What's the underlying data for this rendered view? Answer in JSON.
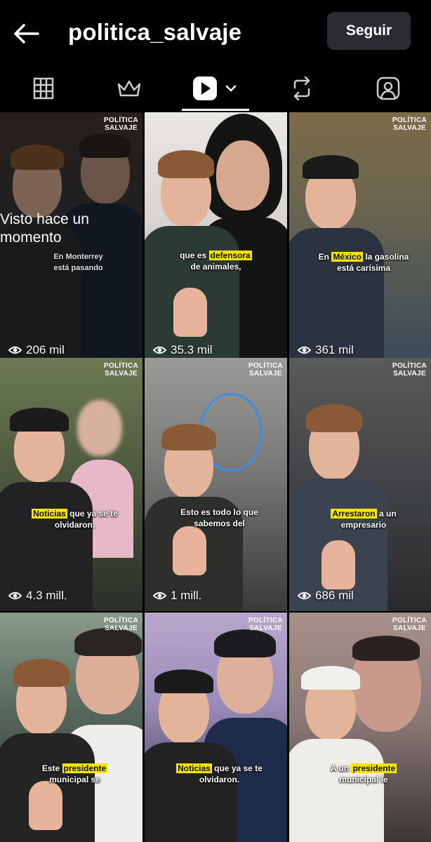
{
  "header": {
    "back_icon": "arrow-left-icon",
    "title": "politica_salvaje",
    "follow_label": "Seguir"
  },
  "tabs": [
    {
      "name": "grid",
      "icon": "grid-icon"
    },
    {
      "name": "crown",
      "icon": "crown-icon"
    },
    {
      "name": "videos",
      "icon": "play-icon",
      "active": true
    },
    {
      "name": "reposts",
      "icon": "repost-icon"
    },
    {
      "name": "tagged",
      "icon": "tagged-person-icon"
    }
  ],
  "videos": [
    {
      "brand": "POLÍTICA\nSALVAJE",
      "watched_label": "Visto hace un momento",
      "caption": "En Monterrey\nestá pasando",
      "caption_highlight": "",
      "views": "206 mil"
    },
    {
      "brand": "",
      "caption_pre": "que es ",
      "caption_highlight": "defensora",
      "caption_post": " de animales,",
      "views": "35.3 mil"
    },
    {
      "brand": "POLÍTICA\nSALVAJE",
      "caption_pre": "En ",
      "caption_highlight": "México",
      "caption_post": " la gasolina está carísima",
      "views": "361 mil"
    },
    {
      "brand": "POLÍTICA\nSALVAJE",
      "caption_pre": "",
      "caption_highlight": "Noticias",
      "caption_post": " que ya se te olvidaron.",
      "views": "4.3 mill."
    },
    {
      "brand": "POLÍTICA\nSALVAJE",
      "caption_pre": "Esto es todo lo que sabemos del",
      "caption_highlight": "",
      "caption_post": "",
      "views": "1 mill."
    },
    {
      "brand": "POLÍTICA\nSALVAJE",
      "caption_pre": "",
      "caption_highlight": "Arrestaron",
      "caption_post": " a un empresario",
      "views": "686 mil"
    },
    {
      "brand": "POLÍTICA\nSALVAJE",
      "caption_pre": "Este ",
      "caption_highlight": "presidente",
      "caption_post": " municipal se",
      "views": ""
    },
    {
      "brand": "POLÍTICA\nSALVAJE",
      "caption_pre": "",
      "caption_highlight": "Noticias",
      "caption_post": " que ya se te olvidaron.",
      "views": ""
    },
    {
      "brand": "POLÍTICA\nSALVAJE",
      "caption_pre": "A un ",
      "caption_highlight": "presidente",
      "caption_post": " municipal le",
      "views": ""
    }
  ],
  "colors": {
    "background": "#000000",
    "follow_button": "#2a2c31",
    "caption_highlight": "#f5e400",
    "annotation_circle": "#3a8fe6"
  }
}
